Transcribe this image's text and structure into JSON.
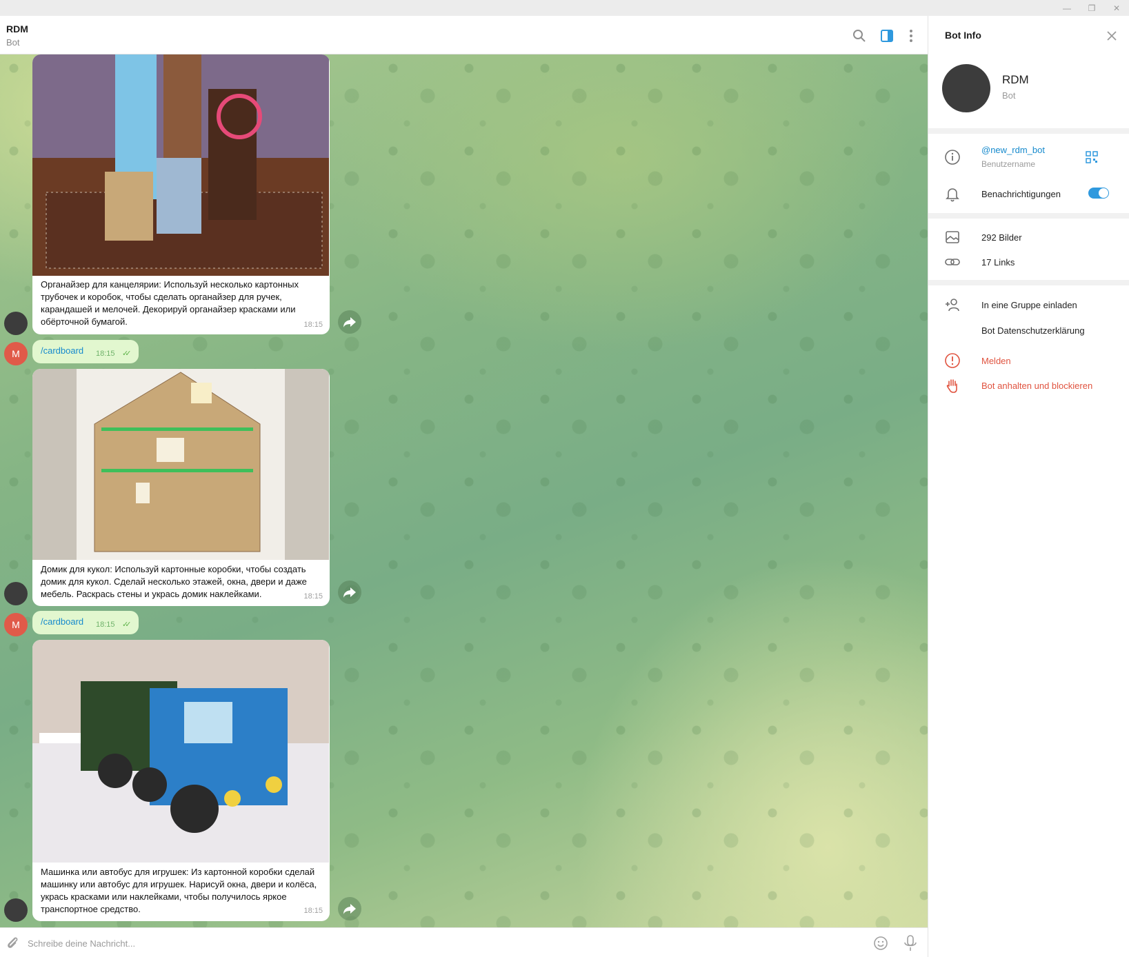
{
  "window": {
    "minimize_glyph": "—",
    "restore_glyph": "❐",
    "close_glyph": "✕"
  },
  "chat": {
    "title": "RDM",
    "subtitle": "Bot"
  },
  "messages": [
    {
      "caption": "Органайзер для канцелярии: Используй несколько картонных трубочек и коробок, чтобы сделать органайзер для ручек, карандашей и мелочей. Декорируй органайзер красками или обёрточной бумагой.",
      "time": "18:15"
    },
    {
      "command": "/cardboard",
      "time": "18:15",
      "avatar_letter": "M"
    },
    {
      "caption": "Домик для кукол: Используй картонные коробки, чтобы создать домик для кукол. Сделай несколько этажей, окна, двери и даже мебель. Раскрась стены и укрась домик наклейками.",
      "time": "18:15"
    },
    {
      "command": "/cardboard",
      "time": "18:15",
      "avatar_letter": "M"
    },
    {
      "caption": "Машинка или автобус для игрушек: Из картонной коробки сделай машинку или автобус для игрушек. Нарисуй окна, двери и колёса, укрась красками или наклейками, чтобы получилось яркое транспортное средство.",
      "time": "18:15"
    }
  ],
  "composer": {
    "placeholder": "Schreibe deine Nachricht..."
  },
  "side_panel": {
    "title": "Bot Info",
    "name": "RDM",
    "subtitle": "Bot",
    "username": "@new_rdm_bot",
    "username_label": "Benutzername",
    "notifications_label": "Benachrichtigungen",
    "notifications_on": true,
    "media": "292 Bilder",
    "links": "17 Links",
    "invite": "In eine Gruppe einladen",
    "privacy": "Bot Datenschutzerklärung",
    "report": "Melden",
    "block": "Bot anhalten und blockieren"
  },
  "colors": {
    "accent": "#168acd",
    "danger": "#e0533f",
    "outgoing": "#e2f7cf",
    "toggle": "#2f99de"
  }
}
